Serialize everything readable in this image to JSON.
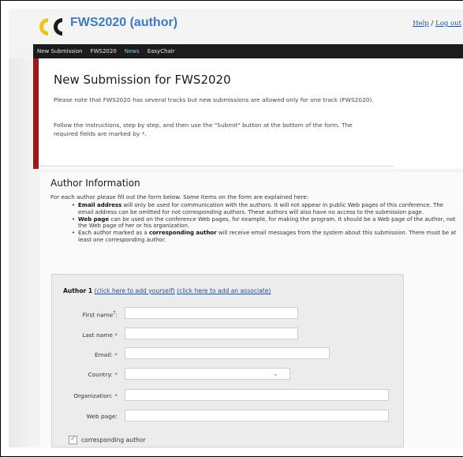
{
  "app": {
    "title": "FWS2020 (author)",
    "help_link": "Help",
    "separator": "/",
    "logout_link": "Log out"
  },
  "nav": {
    "items": [
      "New Submission",
      "FWS2020",
      "News",
      "EasyChair"
    ],
    "active": "News"
  },
  "intro": {
    "title": "New Submission for FWS2020",
    "p1": "Please note that FWS2020 has several tracks but new submissions are allowed only for one track (FWS2020).",
    "p2_before": "Follow the instructions, step by step, and then use the \"Submit\" button at the bottom of the form. The required fields are marked by",
    "p2_mark": "*",
    "p2_after": "."
  },
  "author_info": {
    "title": "Author Information",
    "subtitle": "For each author please fill out the form below. Some items on the form are explained here:",
    "bullets": [
      {
        "bold": "Email address",
        "text": " will only be used for communication with the authors. It will not appear in public Web pages of this conference. The email address can be omitted for not corresponding authors. These authors will also have no access to the submission page."
      },
      {
        "bold": "Web page",
        "text": " can be used on the conference Web pages, for example, for making the program. It should be a Web page of the author, not the Web page of her or his organization."
      },
      {
        "pre": "Each author marked as a ",
        "bold": "corresponding author",
        "text": " will receive email messages from the system about this submission. There must be at least one corresponding author."
      }
    ]
  },
  "form": {
    "author_heading": "Author 1",
    "add_yourself": "(click here to add yourself)",
    "add_associate": "(click here to add an associate)",
    "fields": {
      "first_name": {
        "label": "First name",
        "sup": "†",
        "suffix": ":",
        "value": ""
      },
      "last_name": {
        "label": "Last name",
        "required": "*",
        "value": ""
      },
      "email": {
        "label": "Email:",
        "required": "*",
        "value": ""
      },
      "country": {
        "label": "Country:",
        "required": "*",
        "value": ""
      },
      "organization": {
        "label": "Organization:",
        "required": "*",
        "value": ""
      },
      "web_page": {
        "label": "Web page:",
        "value": ""
      }
    },
    "corresponding_label": "corresponding author",
    "corresponding_checked": true
  },
  "colors": {
    "accent_blue": "#3d7bbf",
    "nav_bg": "#1c1c1c",
    "nav_active": "#6fd0e0",
    "red_bar": "#9e1a1a",
    "required": "#cc2222",
    "logo_yellow": "#f0c419"
  },
  "icons": {
    "logo": "easychair-logo-icon",
    "dropdown": "chevron-down-icon",
    "checkbox": "checkmark-icon"
  }
}
